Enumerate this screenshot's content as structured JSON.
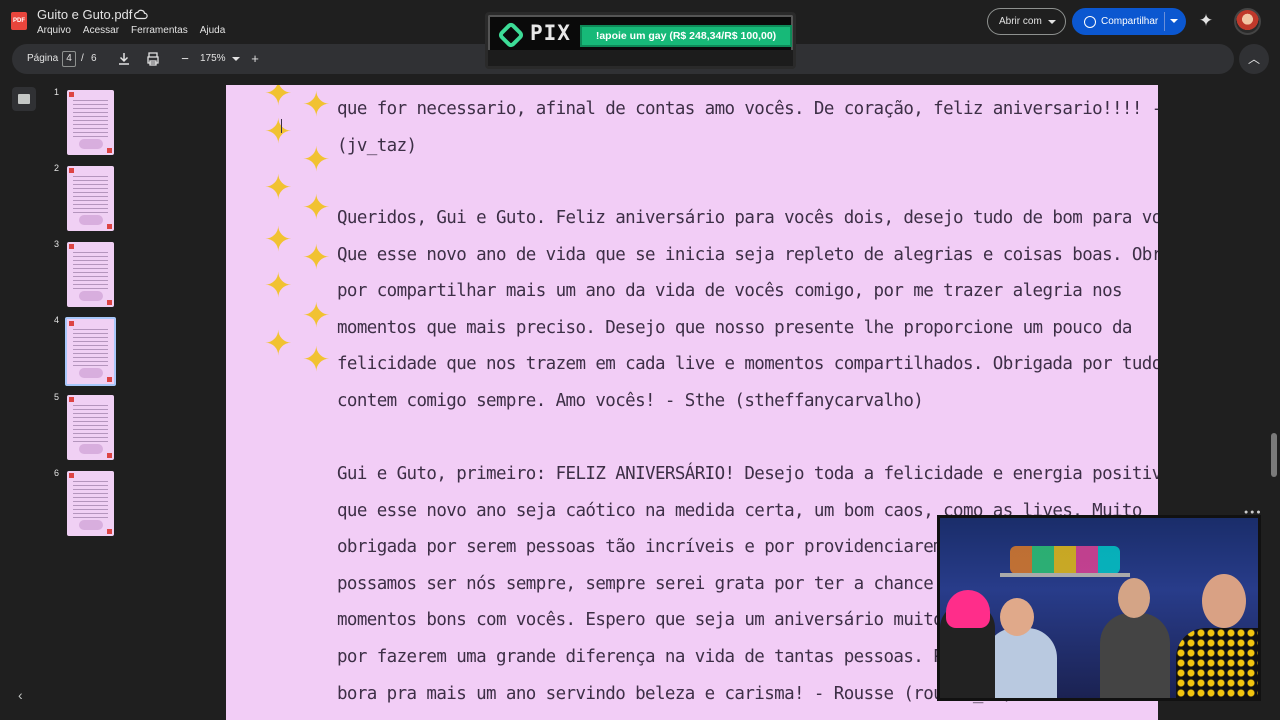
{
  "app": {
    "file_icon_label": "PDF",
    "title": "Guito e Guto.pdf",
    "menu": [
      "Arquivo",
      "Acessar",
      "Ferramentas",
      "Ajuda"
    ],
    "open_with_label": "Abrir com",
    "share_label": "Compartilhar"
  },
  "toolbar": {
    "page_label": "Página",
    "current_page": "4",
    "separator": "/",
    "total_pages": "6",
    "zoom": "175%"
  },
  "pix": {
    "logo_text": "PIX",
    "goal_text": "!apoie um gay (R$ 248,34/R$ 100,00)"
  },
  "thumbnails": [
    {
      "num": "1",
      "active": false
    },
    {
      "num": "2",
      "active": false
    },
    {
      "num": "3",
      "active": false
    },
    {
      "num": "4",
      "active": true
    },
    {
      "num": "5",
      "active": false
    },
    {
      "num": "6",
      "active": false
    }
  ],
  "document": {
    "messages": [
      {
        "lines": [
          "que for necessario, afinal de contas amo vocês. De coração, feliz aniversario!!!! - JV",
          "(jv_taz)"
        ]
      },
      {
        "lines": [
          "Queridos, Gui e Guto. Feliz aniversário para vocês dois, desejo tudo de bom para vocês.",
          "Que esse novo ano de vida que se inicia seja repleto de alegrias e coisas boas. Obrigada",
          "por compartilhar mais um ano da vida de vocês comigo, por me trazer alegria nos",
          "momentos que mais preciso. Desejo que nosso presente lhe proporcione um pouco da",
          "felicidade que nos trazem em cada live e momentos compartilhados. Obrigada por tudo,",
          "contem comigo sempre. Amo vocês! - Sthe (stheffanycarvalho)"
        ]
      },
      {
        "lines": [
          "Gui e Guto, primeiro: FELIZ ANIVERSÁRIO! Desejo toda a felicidade e energia positiva para",
          "que esse novo ano seja caótico na medida certa, um bom caos, como as lives. Muito",
          "obrigada por serem pessoas tão incríveis e por providenciarem um lugar s",
          "possamos ser nós sempre, sempre serei grata por ter a chance de compar",
          "momentos bons com vocês. Espero que seja um aniversário muito bom e, de m",
          "por fazerem uma grande diferença na vida de tantas pessoas. Parabéns! A",
          "bora pra mais um ano servindo beleza e carisma!  - Rousse (rousse_ac)"
        ]
      }
    ]
  },
  "colors": {
    "page_bg": "#f2cdf6",
    "text": "#3d2f46",
    "star": "#f1c232",
    "share_button": "#0b57d0",
    "pix_bar": "#17b978"
  }
}
